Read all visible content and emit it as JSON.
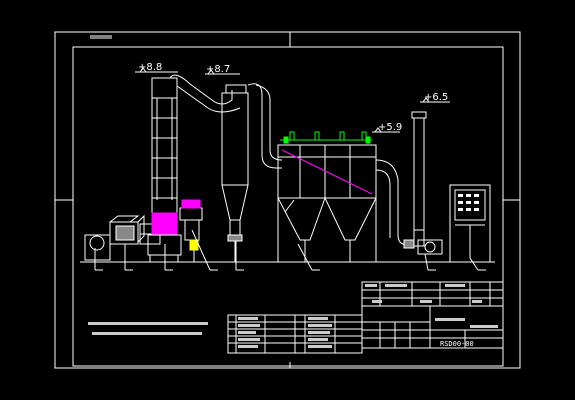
{
  "drawing": {
    "elevations": [
      "+8.8",
      "+8.7",
      "+5.9",
      "+6.5"
    ],
    "drawing_number": "RSD00-00",
    "colors": {
      "background": "#000000",
      "line": "#ffffff",
      "accent_magenta": "#ff00ff",
      "accent_green": "#00ff00",
      "accent_yellow": "#ffff00"
    }
  }
}
